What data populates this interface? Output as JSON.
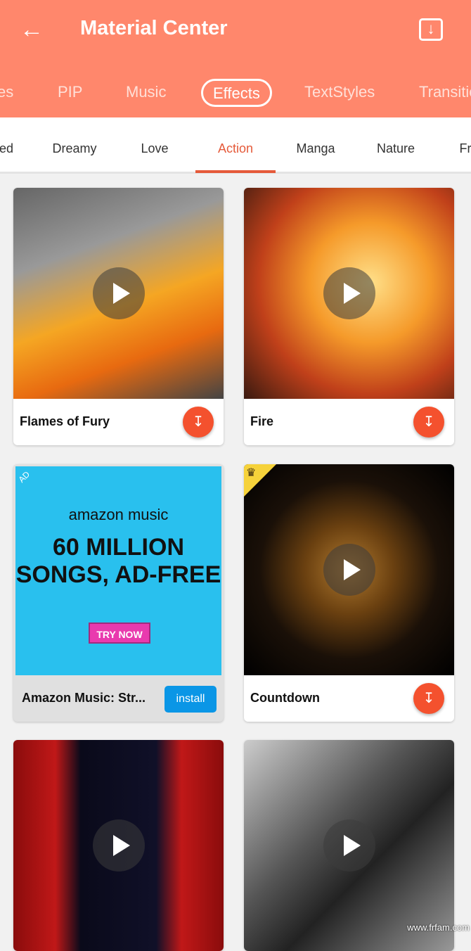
{
  "header": {
    "title": "Material Center",
    "back_icon": "arrow-left-icon",
    "download_icon": "download-box-icon",
    "color": "#ff876c"
  },
  "tabs": [
    {
      "label": "es"
    },
    {
      "label": "PIP"
    },
    {
      "label": "Music"
    },
    {
      "label": "Effects",
      "active": true
    },
    {
      "label": "TextStyles"
    },
    {
      "label": "Transitio"
    }
  ],
  "subtabs": [
    {
      "label": "ured"
    },
    {
      "label": "Dreamy"
    },
    {
      "label": "Love"
    },
    {
      "label": "Action",
      "active": true
    },
    {
      "label": "Manga"
    },
    {
      "label": "Nature"
    },
    {
      "label": "Fra"
    }
  ],
  "items": [
    {
      "name": "Flames of Fury"
    },
    {
      "name": "Fire"
    },
    {
      "ad": true,
      "badge": "AD",
      "brand": "amazon music",
      "headline": "60 MILLION SONGS, AD-FREE",
      "cta": "TRY NOW",
      "name": "Amazon Music: Str...",
      "install": "install"
    },
    {
      "name": "Countdown",
      "premium": true
    },
    {
      "name": ""
    },
    {
      "name": ""
    }
  ],
  "watermark": "www.frfam.com"
}
